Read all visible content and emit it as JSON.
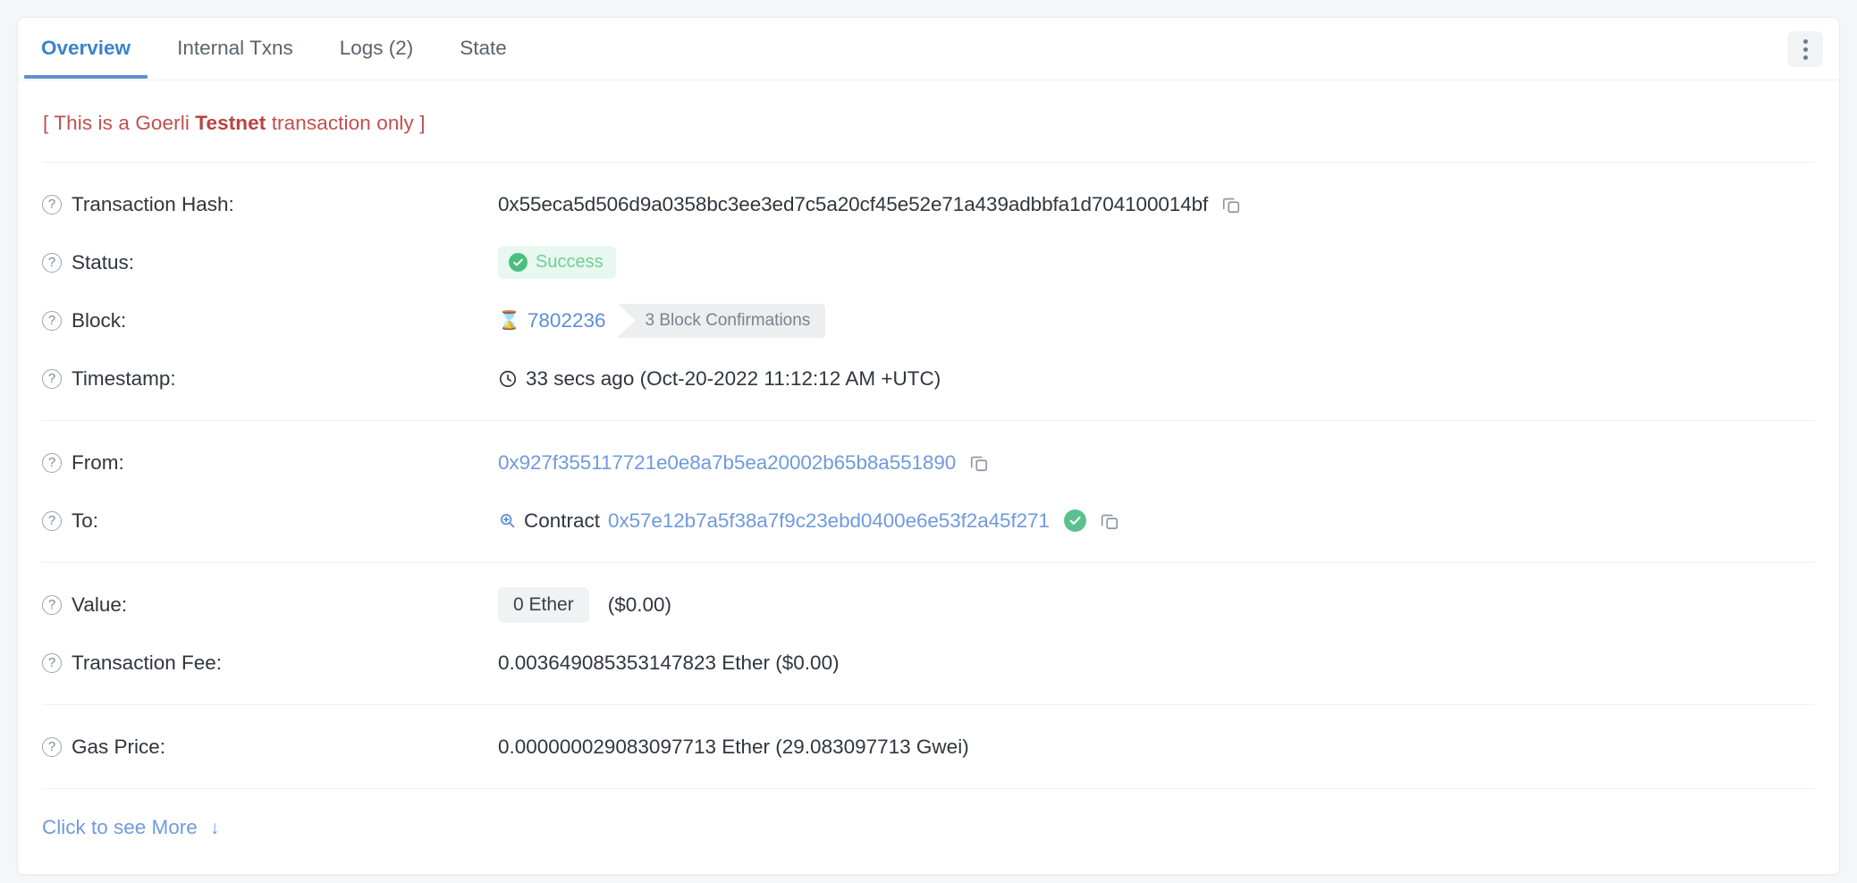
{
  "tabs": [
    {
      "label": "Overview",
      "active": true
    },
    {
      "label": "Internal Txns",
      "active": false
    },
    {
      "label": "Logs (2)",
      "active": false
    },
    {
      "label": "State",
      "active": false
    }
  ],
  "overflow_menu": {
    "name": "more-options",
    "icon": "kebab-menu-icon"
  },
  "notice": {
    "prefix": "[ This is a Goerli ",
    "emphasis": "Testnet",
    "suffix": " transaction only ]",
    "color": "#c0504d"
  },
  "rows": {
    "transaction_hash": {
      "label": "Transaction Hash:",
      "value": "0x55eca5d506d9a0358bc3ee3ed7c5a20cf45e52e71a439adbbfa1d704100014bf",
      "copy_icon": "copy-icon"
    },
    "status": {
      "label": "Status:",
      "value": "Success",
      "badge_color": "#e8f8f0",
      "text_color": "#6fcf97"
    },
    "block": {
      "label": "Block:",
      "number": "7802236",
      "confirmations": "3 Block Confirmations",
      "icon": "hourglass-icon"
    },
    "timestamp": {
      "label": "Timestamp:",
      "value": "33 secs ago (Oct-20-2022 11:12:12 AM +UTC)",
      "icon": "clock-icon"
    },
    "from": {
      "label": "From:",
      "value": "0x927f355117721e0e8a7b5ea20002b65b8a551890",
      "copy_icon": "copy-icon"
    },
    "to": {
      "label": "To:",
      "prefix": "Contract",
      "address": "0x57e12b7a5f38a7f9c23ebd0400e6e53f2a45f271",
      "verified_icon": "verified-check-icon",
      "search_icon": "magnifier-icon",
      "copy_icon": "copy-icon"
    },
    "value": {
      "label": "Value:",
      "amount": "0 Ether",
      "usd": "($0.00)"
    },
    "transaction_fee": {
      "label": "Transaction Fee:",
      "value": "0.003649085353147823 Ether ($0.00)"
    },
    "gas_price": {
      "label": "Gas Price:",
      "value": "0.000000029083097713 Ether (29.083097713 Gwei)"
    }
  },
  "footer": {
    "more_label": "Click to see More",
    "arrow": "↓"
  },
  "colors": {
    "link": "#6f9ade",
    "accent": "#5b8fd4",
    "success": "#4bbf7f",
    "notice": "#c0504d"
  }
}
